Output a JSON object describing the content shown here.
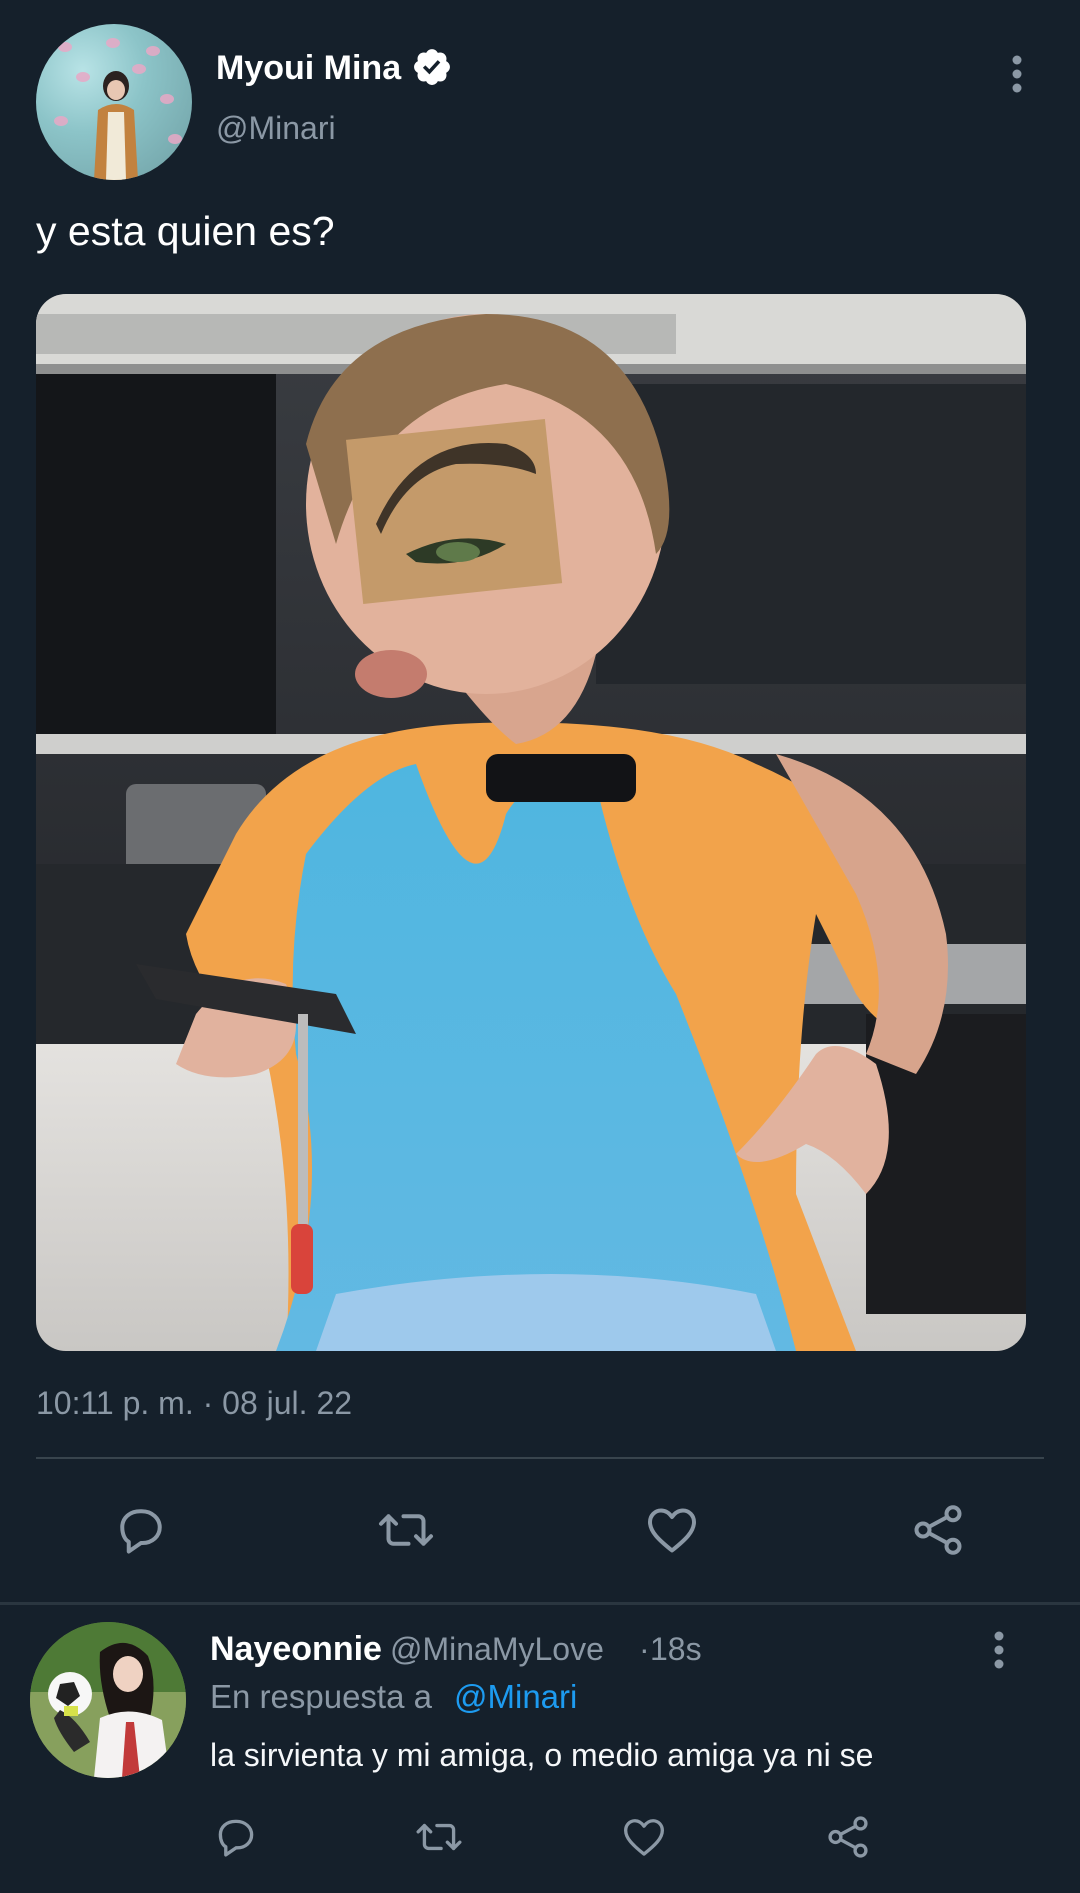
{
  "tweet": {
    "display_name": "Myoui Mina",
    "handle": "@Minari",
    "text": "y esta quien es?",
    "timestamp": "10:11 p. m. · 08 jul. 22",
    "verified": true
  },
  "actions": {
    "reply_icon": "reply-icon",
    "retweet_icon": "retweet-icon",
    "like_icon": "heart-icon",
    "share_icon": "share-icon"
  },
  "reply": {
    "display_name": "Nayeonnie",
    "handle": "@MinaMyLove",
    "separator": "·",
    "time": "18s",
    "context_prefix": "En respuesta a",
    "context_mention": "@Minari",
    "text": "la sirvienta y mi amiga, o medio amiga ya ni se"
  },
  "colors": {
    "background": "#15202b",
    "secondary_text": "#8b98a5",
    "link": "#1d9bf0",
    "divider": "#38444d"
  }
}
